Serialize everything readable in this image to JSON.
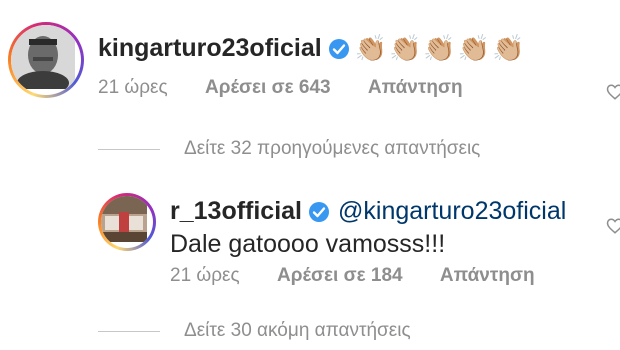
{
  "comment1": {
    "username": "kingarturo23oficial",
    "emoji": "👏🏼👏🏼👏🏼👏🏼👏🏼",
    "time": "21 ώρες",
    "likes": "Αρέσει σε 643",
    "reply": "Απάντηση",
    "avatar_icon": "profile-photo"
  },
  "view_previous": "Δείτε 32 προηγούμενες απαντήσεις",
  "comment2": {
    "username": "r_13official",
    "mention": "@kingarturo23oficial",
    "text": "Dale gatoooo vamosss!!!",
    "time": "21 ώρες",
    "likes": "Αρέσει σε 184",
    "reply": "Απάντηση",
    "avatar_icon": "profile-photo"
  },
  "view_more": "Δείτε 30 ακόμη απαντήσεις",
  "colors": {
    "verified": "#3897f0",
    "mention": "#00376b",
    "meta": "#8e8e8e"
  }
}
